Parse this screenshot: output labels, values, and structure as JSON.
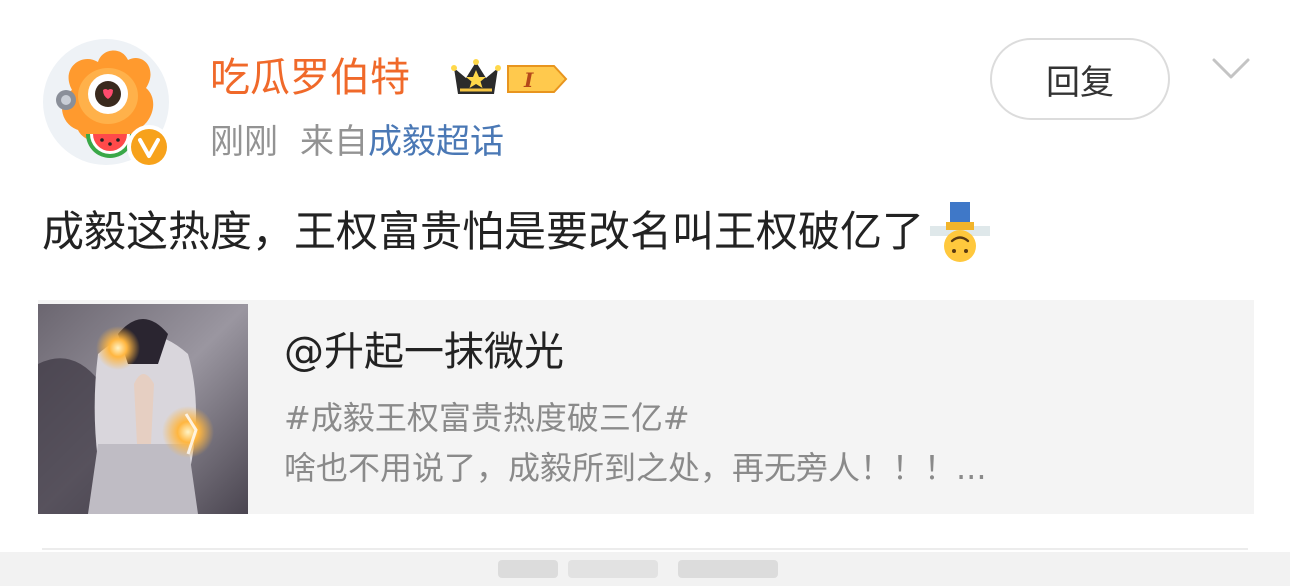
{
  "post": {
    "username": "吃瓜罗伯特",
    "badge_level": "I",
    "time": "刚刚",
    "source_prefix": "来自",
    "source_topic": "成毅超话",
    "reply_label": "回复",
    "text": "成毅这热度，王权富贵怕是要改名叫王权破亿了",
    "emoji": "upside-down-face-emoji"
  },
  "quote": {
    "user": "@升起一抹微光",
    "hashtag": "#成毅王权富贵热度破三亿#",
    "body": "啥也不用说了，成毅所到之处，再无旁人！！！..."
  },
  "colors": {
    "username": "#f0692a",
    "topic_link": "#4a78b5",
    "meta_text": "#939393",
    "card_bg": "#f4f4f4",
    "verified": "#f7a21b"
  },
  "icons": [
    "avatar-mascot",
    "verified-icon",
    "crown-badge-icon",
    "chevron-down-icon",
    "upside-down-face-emoji"
  ]
}
